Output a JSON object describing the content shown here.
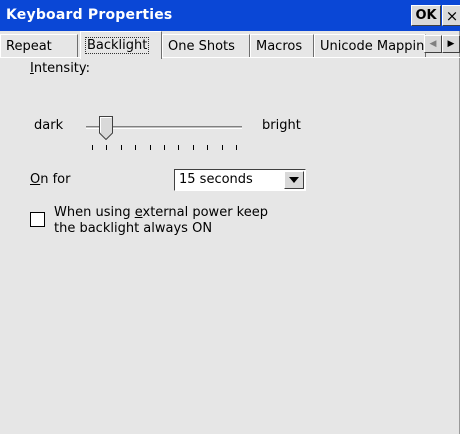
{
  "window": {
    "title": "Keyboard Properties",
    "ok_label": "OK",
    "close_label": "×"
  },
  "tabs": [
    {
      "label": "Repeat",
      "active": false
    },
    {
      "label": "Backlight",
      "active": true
    },
    {
      "label": "One Shots",
      "active": false
    },
    {
      "label": "Macros",
      "active": false
    },
    {
      "label": "Unicode Mappin",
      "active": false
    }
  ],
  "tab_scroll": {
    "left_icon": "arrow-left-icon",
    "right_icon": "arrow-right-icon"
  },
  "intensity": {
    "label_prefix": "",
    "label_hotkey": "I",
    "label_rest": "ntensity:",
    "min_label": "dark",
    "max_label": "bright",
    "level": 0.1,
    "tick_count": 11
  },
  "on_for": {
    "label_hotkey": "O",
    "label_rest": "n for",
    "value": "15 seconds"
  },
  "external_power": {
    "checked": false,
    "line1_prefix": "When using ",
    "line1_hotkey": "e",
    "line1_rest": "xternal power keep",
    "line2": "the backlight always ON"
  },
  "colors": {
    "titlebar": "#0a47d6",
    "window_bg": "#e6e6e6"
  }
}
